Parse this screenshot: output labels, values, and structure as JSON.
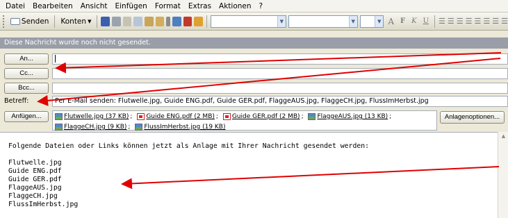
{
  "menu": {
    "items": [
      "Datei",
      "Bearbeiten",
      "Ansicht",
      "Einfügen",
      "Format",
      "Extras",
      "Aktionen",
      "?"
    ]
  },
  "toolbar": {
    "send_label": "Senden",
    "accounts_label": "Konten",
    "format_buttons": [
      "A",
      "F",
      "K",
      "U"
    ]
  },
  "infobar": {
    "text": "Diese Nachricht wurde noch nicht gesendet."
  },
  "header": {
    "to_button": "An...",
    "cc_button": "Cc...",
    "bcc_button": "Bcc...",
    "subject_label": "Betreff:",
    "subject_value": "Per E-Mail senden: Flutwelle.jpg, Guide ENG.pdf, Guide GER.pdf, FlaggeAUS.jpg, FlaggeCH.jpg, FlussImHerbst.jpg",
    "attach_button": "Anfügen...",
    "attach_options_button": "Anlagenoptionen..."
  },
  "attachments": [
    {
      "name": "Flutwelle.jpg (37 KB)",
      "icon": "image-icon"
    },
    {
      "name": "Guide ENG.pdf (2 MB)",
      "icon": "pdf-icon"
    },
    {
      "name": "Guide GER.pdf (2 MB)",
      "icon": "pdf-icon"
    },
    {
      "name": "FlaggeAUS.jpg (13 KB)",
      "icon": "image-icon"
    },
    {
      "name": "FlaggeCH.jpg (9 KB)",
      "icon": "image-icon"
    },
    {
      "name": "FlussImHerbst.jpg (19 KB)",
      "icon": "image-icon"
    }
  ],
  "body": {
    "lines": [
      "Folgende Dateien oder Links können jetzt als Anlage mit Ihrer Nachricht gesendet werden:",
      "",
      "Flutwelle.jpg",
      "Guide ENG.pdf",
      "Guide GER.pdf",
      "FlaggeAUS.jpg",
      "FlaggeCH.jpg",
      "FlussImHerbst.jpg"
    ]
  },
  "colors": {
    "annotation_arrow": "#e00000",
    "infobar_bg": "#9a9ea8"
  }
}
